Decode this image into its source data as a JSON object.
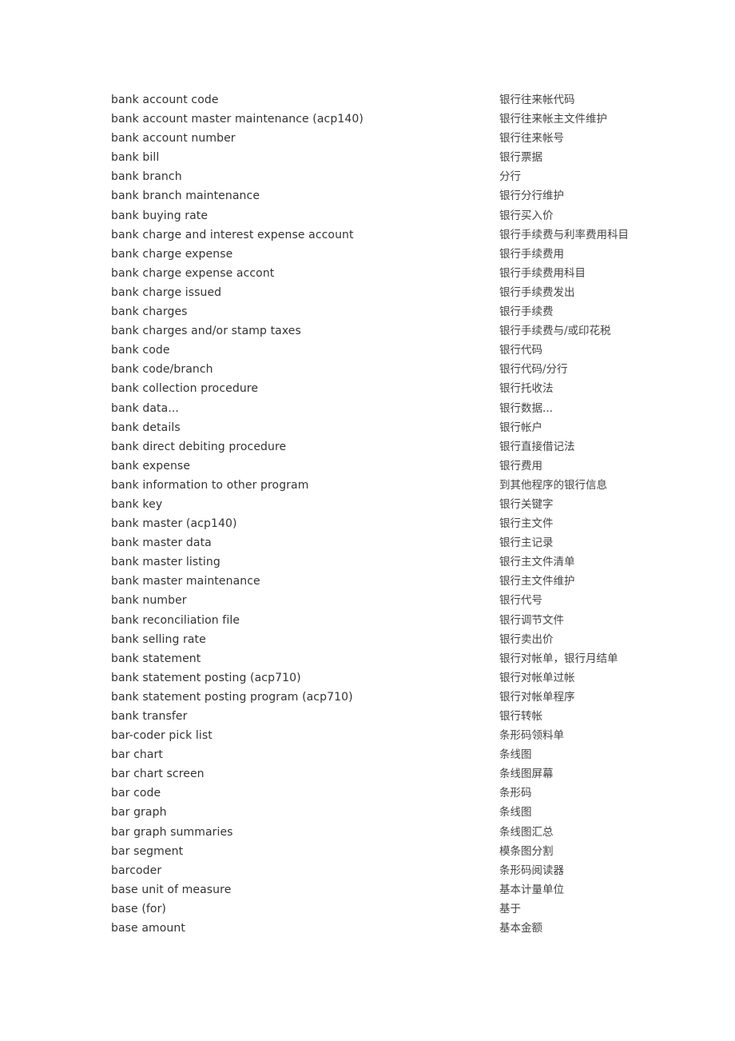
{
  "glossary": {
    "entries": [
      {
        "en": "bank account code",
        "zh": "银行往来帐代码"
      },
      {
        "en": "bank account master maintenance (acp140)",
        "zh": "银行往来帐主文件维护"
      },
      {
        "en": "bank account number",
        "zh": "银行往来帐号"
      },
      {
        "en": "bank bill",
        "zh": "银行票据"
      },
      {
        "en": "bank branch",
        "zh": "分行"
      },
      {
        "en": "bank branch maintenance",
        "zh": "银行分行维护"
      },
      {
        "en": "bank buying rate",
        "zh": "银行买入价"
      },
      {
        "en": "bank charge and interest expense account",
        "zh": "银行手续费与利率费用科目"
      },
      {
        "en": "bank charge expense",
        "zh": "银行手续费用"
      },
      {
        "en": "bank charge expense accont",
        "zh": "银行手续费用科目"
      },
      {
        "en": "bank charge issued",
        "zh": "银行手续费发出"
      },
      {
        "en": "bank charges",
        "zh": "银行手续费"
      },
      {
        "en": "bank charges and/or stamp taxes",
        "zh": "银行手续费与/或印花税"
      },
      {
        "en": "bank code",
        "zh": "银行代码"
      },
      {
        "en": "bank code/branch",
        "zh": "银行代码/分行"
      },
      {
        "en": "bank collection procedure",
        "zh": "银行托收法"
      },
      {
        "en": "bank data...",
        "zh": "银行数据..."
      },
      {
        "en": "bank details",
        "zh": "银行帐户"
      },
      {
        "en": "bank direct debiting procedure",
        "zh": "银行直接借记法"
      },
      {
        "en": "bank expense",
        "zh": "银行费用"
      },
      {
        "en": "bank information to other program",
        "zh": "到其他程序的银行信息"
      },
      {
        "en": "bank key",
        "zh": "银行关键字"
      },
      {
        "en": "bank master (acp140)",
        "zh": "银行主文件"
      },
      {
        "en": "bank master data",
        "zh": "银行主记录"
      },
      {
        "en": "bank master listing",
        "zh": "银行主文件清单"
      },
      {
        "en": "bank master maintenance",
        "zh": "银行主文件维护"
      },
      {
        "en": "bank number",
        "zh": "银行代号"
      },
      {
        "en": "bank reconciliation file",
        "zh": "银行调节文件"
      },
      {
        "en": "bank selling rate",
        "zh": "银行卖出价"
      },
      {
        "en": "bank statement",
        "zh": "银行对帐单，银行月结单"
      },
      {
        "en": "bank statement posting (acp710)",
        "zh": "银行对帐单过帐"
      },
      {
        "en": "bank statement posting program (acp710)",
        "zh": "银行对帐单程序"
      },
      {
        "en": "bank transfer",
        "zh": "银行转帐"
      },
      {
        "en": "bar-coder pick list",
        "zh": "条形码领料单"
      },
      {
        "en": "bar chart",
        "zh": "条线图"
      },
      {
        "en": "bar chart screen",
        "zh": "条线图屏幕"
      },
      {
        "en": "bar code",
        "zh": "条形码"
      },
      {
        "en": "bar graph",
        "zh": "条线图"
      },
      {
        "en": "bar graph summaries",
        "zh": "条线图汇总"
      },
      {
        "en": "bar segment",
        "zh": "模条图分割"
      },
      {
        "en": "barcoder",
        "zh": "条形码阅读器"
      },
      {
        "en": "base unit of measure",
        "zh": "基本计量单位"
      },
      {
        "en": "base (for)",
        "zh": "基于"
      },
      {
        "en": "base amount",
        "zh": "基本金额"
      }
    ]
  }
}
